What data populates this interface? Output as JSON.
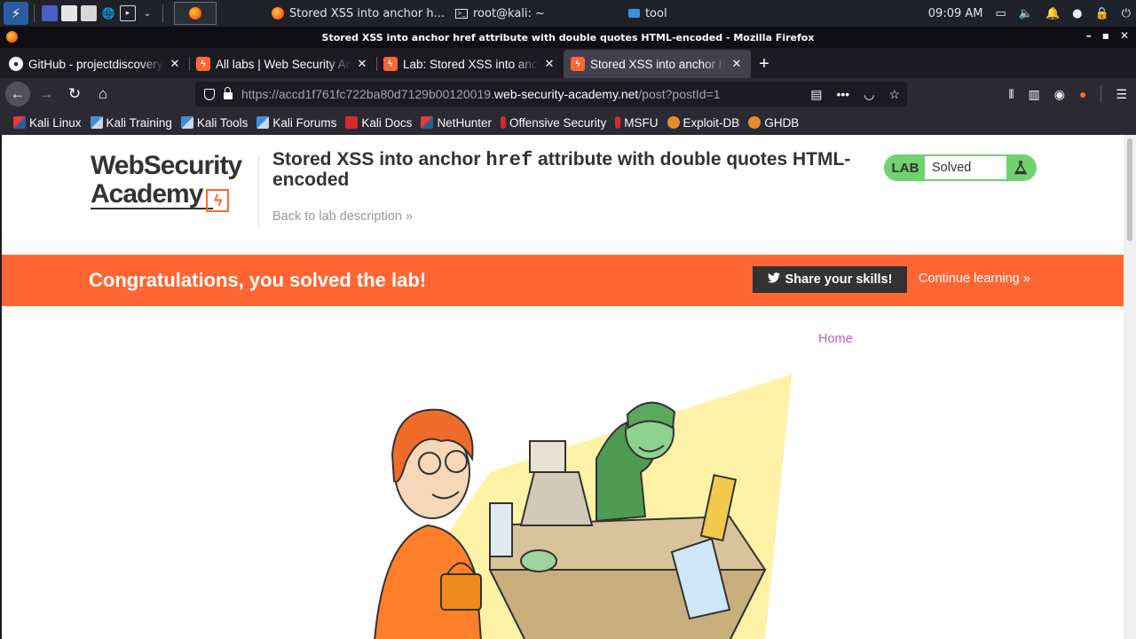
{
  "panel": {
    "tasks": [
      {
        "label": "Stored XSS into anchor h...",
        "icon": "firefox-icon"
      },
      {
        "label": "root@kali: ~",
        "icon": "terminal-icon"
      },
      {
        "label": "tool",
        "icon": "folder-icon"
      }
    ],
    "clock": "09:09 AM"
  },
  "window_title": "Stored XSS into anchor href attribute with double quotes HTML-encoded - Mozilla Firefox",
  "tabs": [
    {
      "label": "GitHub - projectdiscovery",
      "favicon": "github-icon",
      "active": false
    },
    {
      "label": "All labs | Web Security Academy",
      "favicon": "portswigger-icon",
      "active": false
    },
    {
      "label": "Lab: Stored XSS into anchor href",
      "favicon": "portswigger-icon",
      "active": false
    },
    {
      "label": "Stored XSS into anchor href",
      "favicon": "portswigger-icon",
      "active": true
    }
  ],
  "url": {
    "prefix": "https://accd1f761fc722ba80d7129b00120019.",
    "domain": "web-security-academy.net",
    "path": "/post?postId=1"
  },
  "bookmarks": [
    {
      "label": "Kali Linux",
      "icon": "kali-icon"
    },
    {
      "label": "Kali Training",
      "icon": "kali-training-icon"
    },
    {
      "label": "Kali Tools",
      "icon": "kali-tools-icon"
    },
    {
      "label": "Kali Forums",
      "icon": "kali-forums-icon"
    },
    {
      "label": "Kali Docs",
      "icon": "kali-docs-icon"
    },
    {
      "label": "NetHunter",
      "icon": "nethunter-icon"
    },
    {
      "label": "Offensive Security",
      "icon": "offsec-icon"
    },
    {
      "label": "MSFU",
      "icon": "msfu-icon"
    },
    {
      "label": "Exploit-DB",
      "icon": "exploitdb-icon"
    },
    {
      "label": "GHDB",
      "icon": "ghdb-icon"
    }
  ],
  "page": {
    "logo_line1": "WebSecurity",
    "logo_line2": "Academy",
    "title_before": "Stored XSS into anchor ",
    "title_code": "href",
    "title_after": " attribute with double quotes HTML-encoded",
    "back_link": "Back to lab description »",
    "lab_badge": "LAB",
    "lab_status": "Solved",
    "banner_message": "Congratulations, you solved the lab!",
    "share_button": "Share your skills!",
    "continue_link": "Continue learning »",
    "home_link": "Home"
  },
  "colors": {
    "accent": "#ff6633",
    "solved": "#70d16d",
    "link": "#b562cf"
  }
}
